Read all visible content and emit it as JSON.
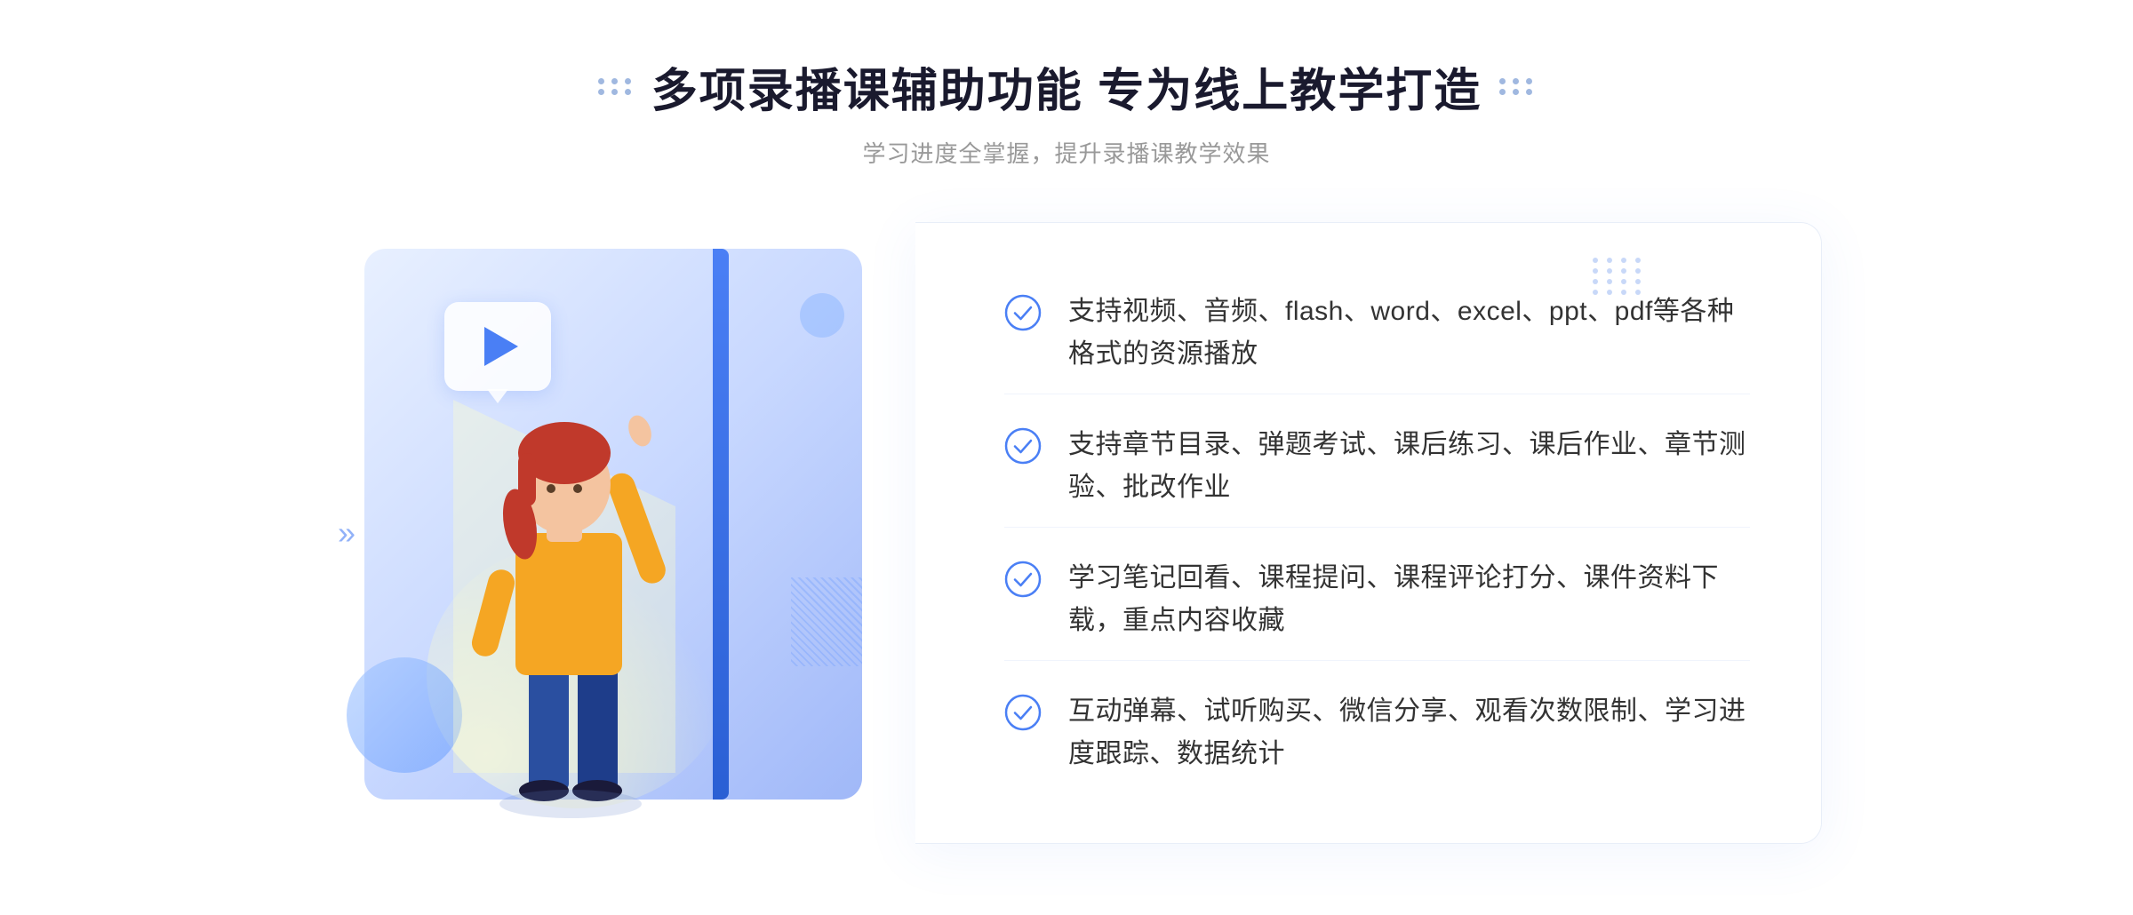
{
  "header": {
    "title": "多项录播课辅助功能 专为线上教学打造",
    "subtitle": "学习进度全掌握，提升录播课教学效果",
    "dots_left": [
      1,
      1,
      1,
      1,
      1,
      1
    ],
    "dots_right": [
      1,
      1,
      1,
      1,
      1,
      1
    ]
  },
  "features": [
    {
      "id": 1,
      "text": "支持视频、音频、flash、word、excel、ppt、pdf等各种格式的资源播放"
    },
    {
      "id": 2,
      "text": "支持章节目录、弹题考试、课后练习、课后作业、章节测验、批改作业"
    },
    {
      "id": 3,
      "text": "学习笔记回看、课程提问、课程评论打分、课件资料下载，重点内容收藏"
    },
    {
      "id": 4,
      "text": "互动弹幕、试听购买、微信分享、观看次数限制、学习进度跟踪、数据统计"
    }
  ],
  "colors": {
    "accent": "#4a7ff5",
    "title": "#1a1a2e",
    "subtitle": "#999999",
    "text": "#333333",
    "check": "#4a7ff5",
    "bg_card": "#dde8ff"
  }
}
